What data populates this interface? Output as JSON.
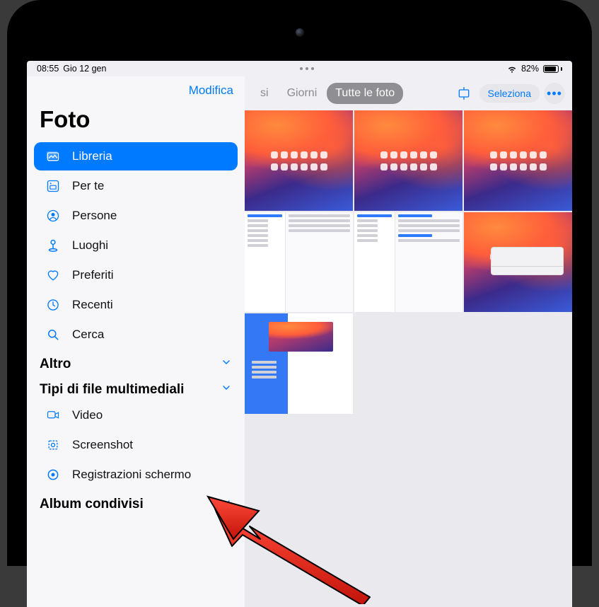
{
  "status": {
    "time": "08:55",
    "date": "Gio 12 gen",
    "battery_pct": "82%"
  },
  "sidebar": {
    "edit_label": "Modifica",
    "title": "Foto",
    "items": [
      {
        "label": "Libreria",
        "icon": "photo-library-icon",
        "active": true
      },
      {
        "label": "Per te",
        "icon": "for-you-icon"
      },
      {
        "label": "Persone",
        "icon": "people-icon"
      },
      {
        "label": "Luoghi",
        "icon": "places-icon"
      },
      {
        "label": "Preferiti",
        "icon": "heart-icon"
      },
      {
        "label": "Recenti",
        "icon": "clock-icon"
      },
      {
        "label": "Cerca",
        "icon": "search-icon"
      }
    ],
    "sections": [
      {
        "label": "Altro"
      },
      {
        "label": "Tipi di file multimediali"
      }
    ],
    "media_types": [
      {
        "label": "Video",
        "icon": "video-icon"
      },
      {
        "label": "Screenshot",
        "icon": "screenshot-icon"
      },
      {
        "label": "Registrazioni schermo",
        "icon": "screen-recording-icon"
      }
    ],
    "shared_section": {
      "label": "Album condivisi"
    }
  },
  "main": {
    "tabs": {
      "mesi": "si",
      "giorni": "Giorni",
      "tutte": "Tutte le foto"
    },
    "select_label": "Seleziona"
  }
}
